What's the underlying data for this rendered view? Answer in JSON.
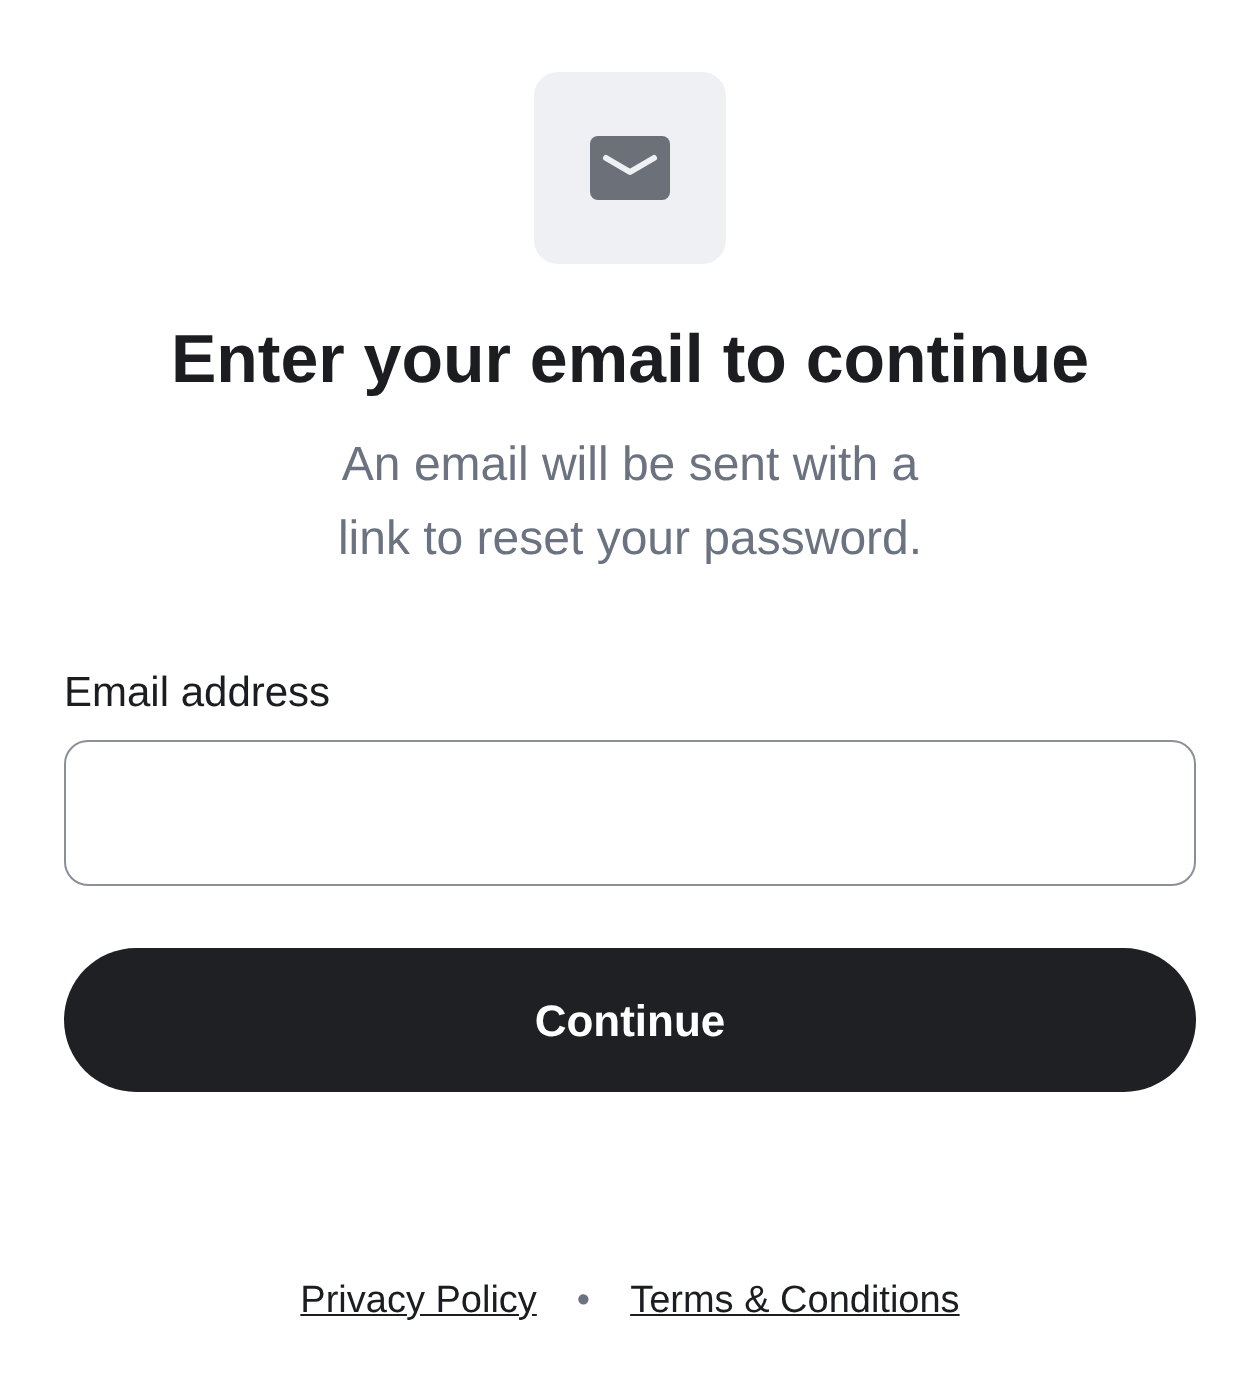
{
  "title": "Enter your email to continue",
  "subtitle": "An email will be sent with a\nlink to reset your password.",
  "email_field": {
    "label": "Email address"
  },
  "continue_button": "Continue",
  "footer_links": [
    "Privacy Policy",
    "Terms & Conditions"
  ],
  "separator": "•"
}
